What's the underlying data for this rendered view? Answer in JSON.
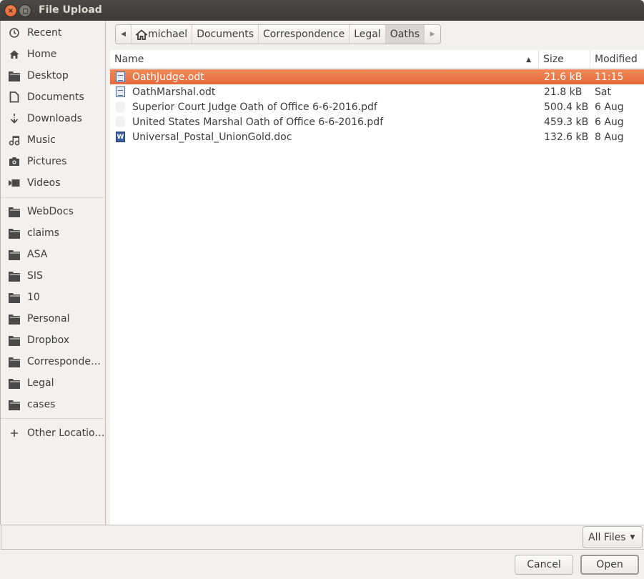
{
  "window": {
    "title": "File Upload"
  },
  "sidebar": {
    "places": [
      {
        "label": "Recent",
        "icon": "clock-icon"
      },
      {
        "label": "Home",
        "icon": "home-icon"
      },
      {
        "label": "Desktop",
        "icon": "folder-icon"
      },
      {
        "label": "Documents",
        "icon": "document-icon"
      },
      {
        "label": "Downloads",
        "icon": "download-icon"
      },
      {
        "label": "Music",
        "icon": "music-icon"
      },
      {
        "label": "Pictures",
        "icon": "camera-icon"
      },
      {
        "label": "Videos",
        "icon": "video-icon"
      }
    ],
    "bookmarks": [
      {
        "label": "WebDocs"
      },
      {
        "label": "claims"
      },
      {
        "label": "ASA"
      },
      {
        "label": "SIS"
      },
      {
        "label": "10"
      },
      {
        "label": "Personal"
      },
      {
        "label": "Dropbox"
      },
      {
        "label": "Corresponde…"
      },
      {
        "label": "Legal"
      },
      {
        "label": "cases"
      }
    ],
    "other": {
      "label": "Other Locatio…"
    }
  },
  "pathbar": {
    "segments": [
      "michael",
      "Documents",
      "Correspondence",
      "Legal",
      "Oaths"
    ],
    "active": "Oaths"
  },
  "filelist": {
    "columns": {
      "name": "Name",
      "size": "Size",
      "modified": "Modified"
    },
    "sort": "name-ascending",
    "rows": [
      {
        "name": "OathJudge.odt",
        "size": "21.6 kB",
        "modified": "11:15",
        "type": "odt",
        "selected": true
      },
      {
        "name": "OathMarshal.odt",
        "size": "21.8 kB",
        "modified": "Sat",
        "type": "odt",
        "selected": false
      },
      {
        "name": "Superior Court Judge Oath of  Office 6-6-2016.pdf",
        "size": "500.4 kB",
        "modified": "6 Aug",
        "type": "pdf",
        "selected": false
      },
      {
        "name": "United States Marshal Oath of  Office 6-6-2016.pdf",
        "size": "459.3 kB",
        "modified": "6 Aug",
        "type": "pdf",
        "selected": false
      },
      {
        "name": "Universal_Postal_UnionGold.doc",
        "size": "132.6 kB",
        "modified": "8 Aug",
        "type": "doc",
        "selected": false
      }
    ]
  },
  "filter": {
    "selected": "All Files"
  },
  "buttons": {
    "cancel": "Cancel",
    "open": "Open"
  },
  "colors": {
    "selection": "#e8693a",
    "titlebar": "#3c3b37",
    "background": "#f2f1f0"
  }
}
